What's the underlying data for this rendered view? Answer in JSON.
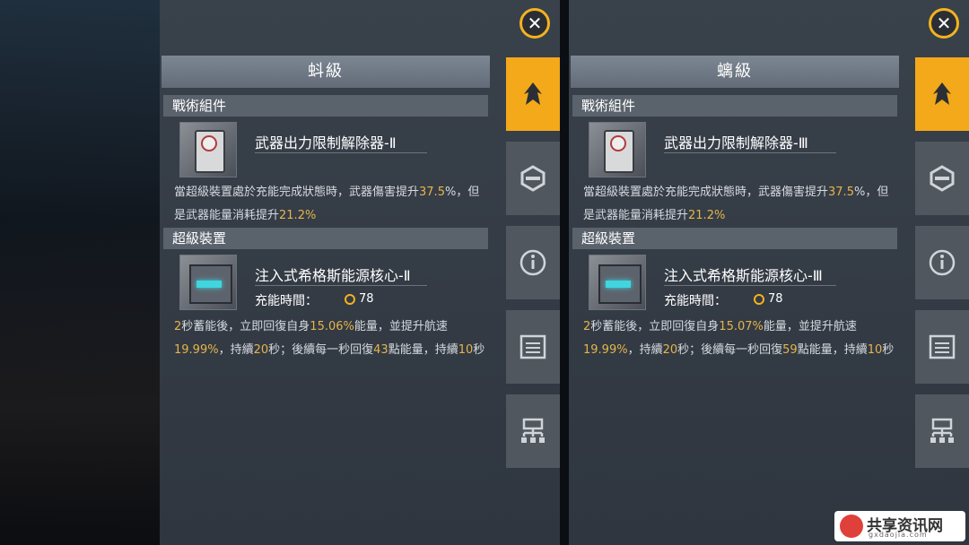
{
  "panels": [
    {
      "level": "蚪級",
      "tactical_header": "戰術組件",
      "tactical_name": "武器出力限制解除器-Ⅱ",
      "tactical_desc": [
        "當超級裝置處於充能完成狀態時，武器傷害提升",
        "37.5",
        "%，但是武器能量消耗提升",
        "21.2%"
      ],
      "super_header": "超級裝置",
      "super_name": "注入式希格斯能源核心-Ⅱ",
      "charge_label": "充能時間：",
      "charge_value": "78",
      "super_desc": [
        "2",
        "秒蓄能後，立即回復自身",
        "15.06%",
        "能量，並提升航速",
        "19.99%",
        "，持續",
        "20",
        "秒；後續每一秒回復",
        "43",
        "點能量，持續",
        "10",
        "秒"
      ]
    },
    {
      "level": "螭級",
      "tactical_header": "戰術組件",
      "tactical_name": "武器出力限制解除器-Ⅲ",
      "tactical_desc": [
        "當超級裝置處於充能完成狀態時，武器傷害提升",
        "37.5",
        "%，但是武器能量消耗提升",
        "21.2%"
      ],
      "super_header": "超級裝置",
      "super_name": "注入式希格斯能源核心-Ⅲ",
      "charge_label": "充能時間：",
      "charge_value": "78",
      "super_desc": [
        "2",
        "秒蓄能後，立即回復自身",
        "15.07%",
        "能量，並提升航速",
        "19.99%",
        "，持續",
        "20",
        "秒；後續每一秒回復",
        "59",
        "點能量，持續",
        "10",
        "秒"
      ]
    }
  ],
  "side_tabs": [
    "ship-class-icon",
    "target-icon",
    "info-icon",
    "list-icon",
    "network-icon"
  ],
  "colors": {
    "accent": "#f3a91a",
    "highlight": "#e6b54a"
  },
  "watermark": {
    "text": "共享资讯网",
    "sub": "gxdaojia.com"
  }
}
